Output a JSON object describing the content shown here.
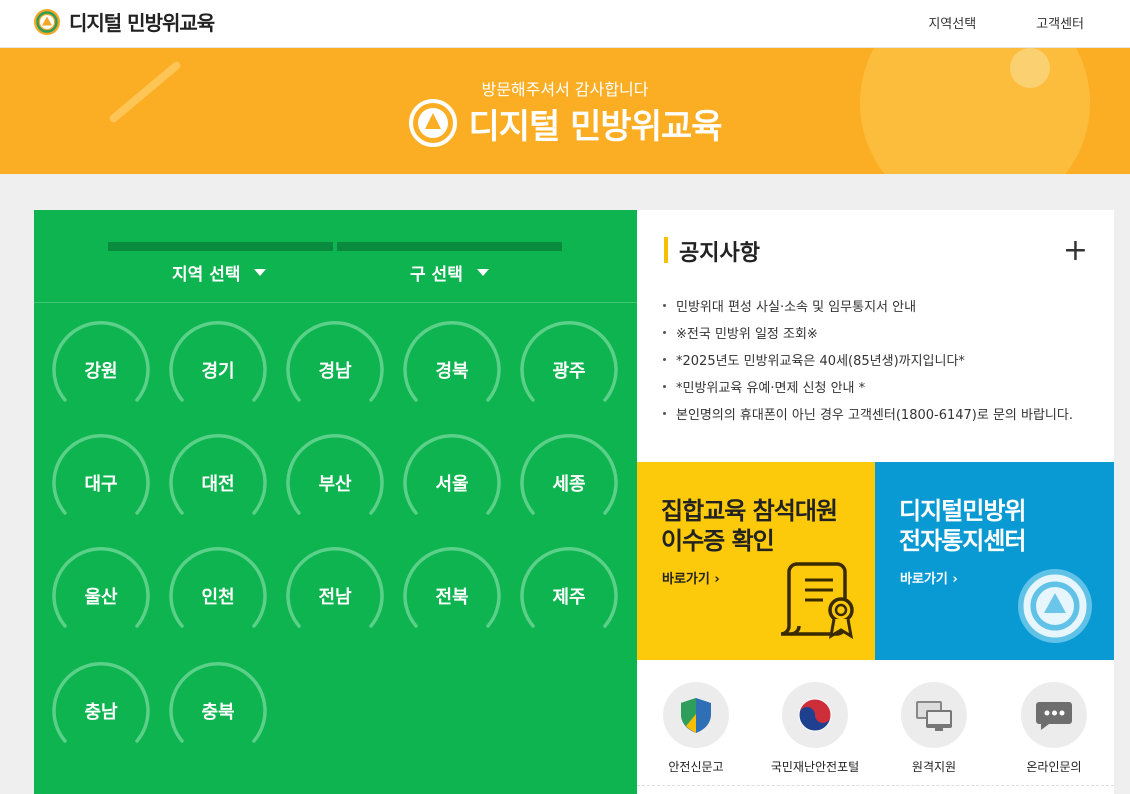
{
  "header": {
    "logo_text": "디지털 민방위교육",
    "nav": [
      "지역선택",
      "고객센터"
    ]
  },
  "banner": {
    "subtitle": "방문해주셔서 감사합니다",
    "title": "디지털 민방위교육"
  },
  "region_panel": {
    "region_select": "지역 선택",
    "district_select": "구 선택",
    "regions": [
      "강원",
      "경기",
      "경남",
      "경북",
      "광주",
      "대구",
      "대전",
      "부산",
      "서울",
      "세종",
      "울산",
      "인천",
      "전남",
      "전북",
      "제주",
      "충남",
      "충북"
    ]
  },
  "notice": {
    "title": "공지사항",
    "more": "+",
    "items": [
      "민방위대 편성 사실·소속 및 임무통지서 안내",
      "※전국 민방위 일정 조회※",
      "*2025년도 민방위교육은 40세(85년생)까지입니다*",
      "*민방위교육 유예·면제 신청 안내 *",
      "본인명의의 휴대폰이 아닌 경우 고객센터(1800-6147)로 문의 바랍니다."
    ]
  },
  "tiles": {
    "certificate": {
      "line1": "집합교육 참석대원",
      "line2": "이수증 확인",
      "link": "바로가기"
    },
    "notification": {
      "line1": "디지털민방위",
      "line2": "전자통지센터",
      "link": "바로가기"
    }
  },
  "quick_links": [
    {
      "label": "안전신문고",
      "icon": "shield-icon"
    },
    {
      "label": "국민재난안전포털",
      "icon": "taegeuk-icon"
    },
    {
      "label": "원격지원",
      "icon": "monitor-icon"
    },
    {
      "label": "온라인문의",
      "icon": "chat-bubble-icon"
    }
  ],
  "colors": {
    "banner": "#fbae24",
    "region_panel": "#0db44f",
    "tile_yellow": "#fcca0a",
    "tile_blue": "#099ad4",
    "notice_accent": "#f6c000"
  }
}
